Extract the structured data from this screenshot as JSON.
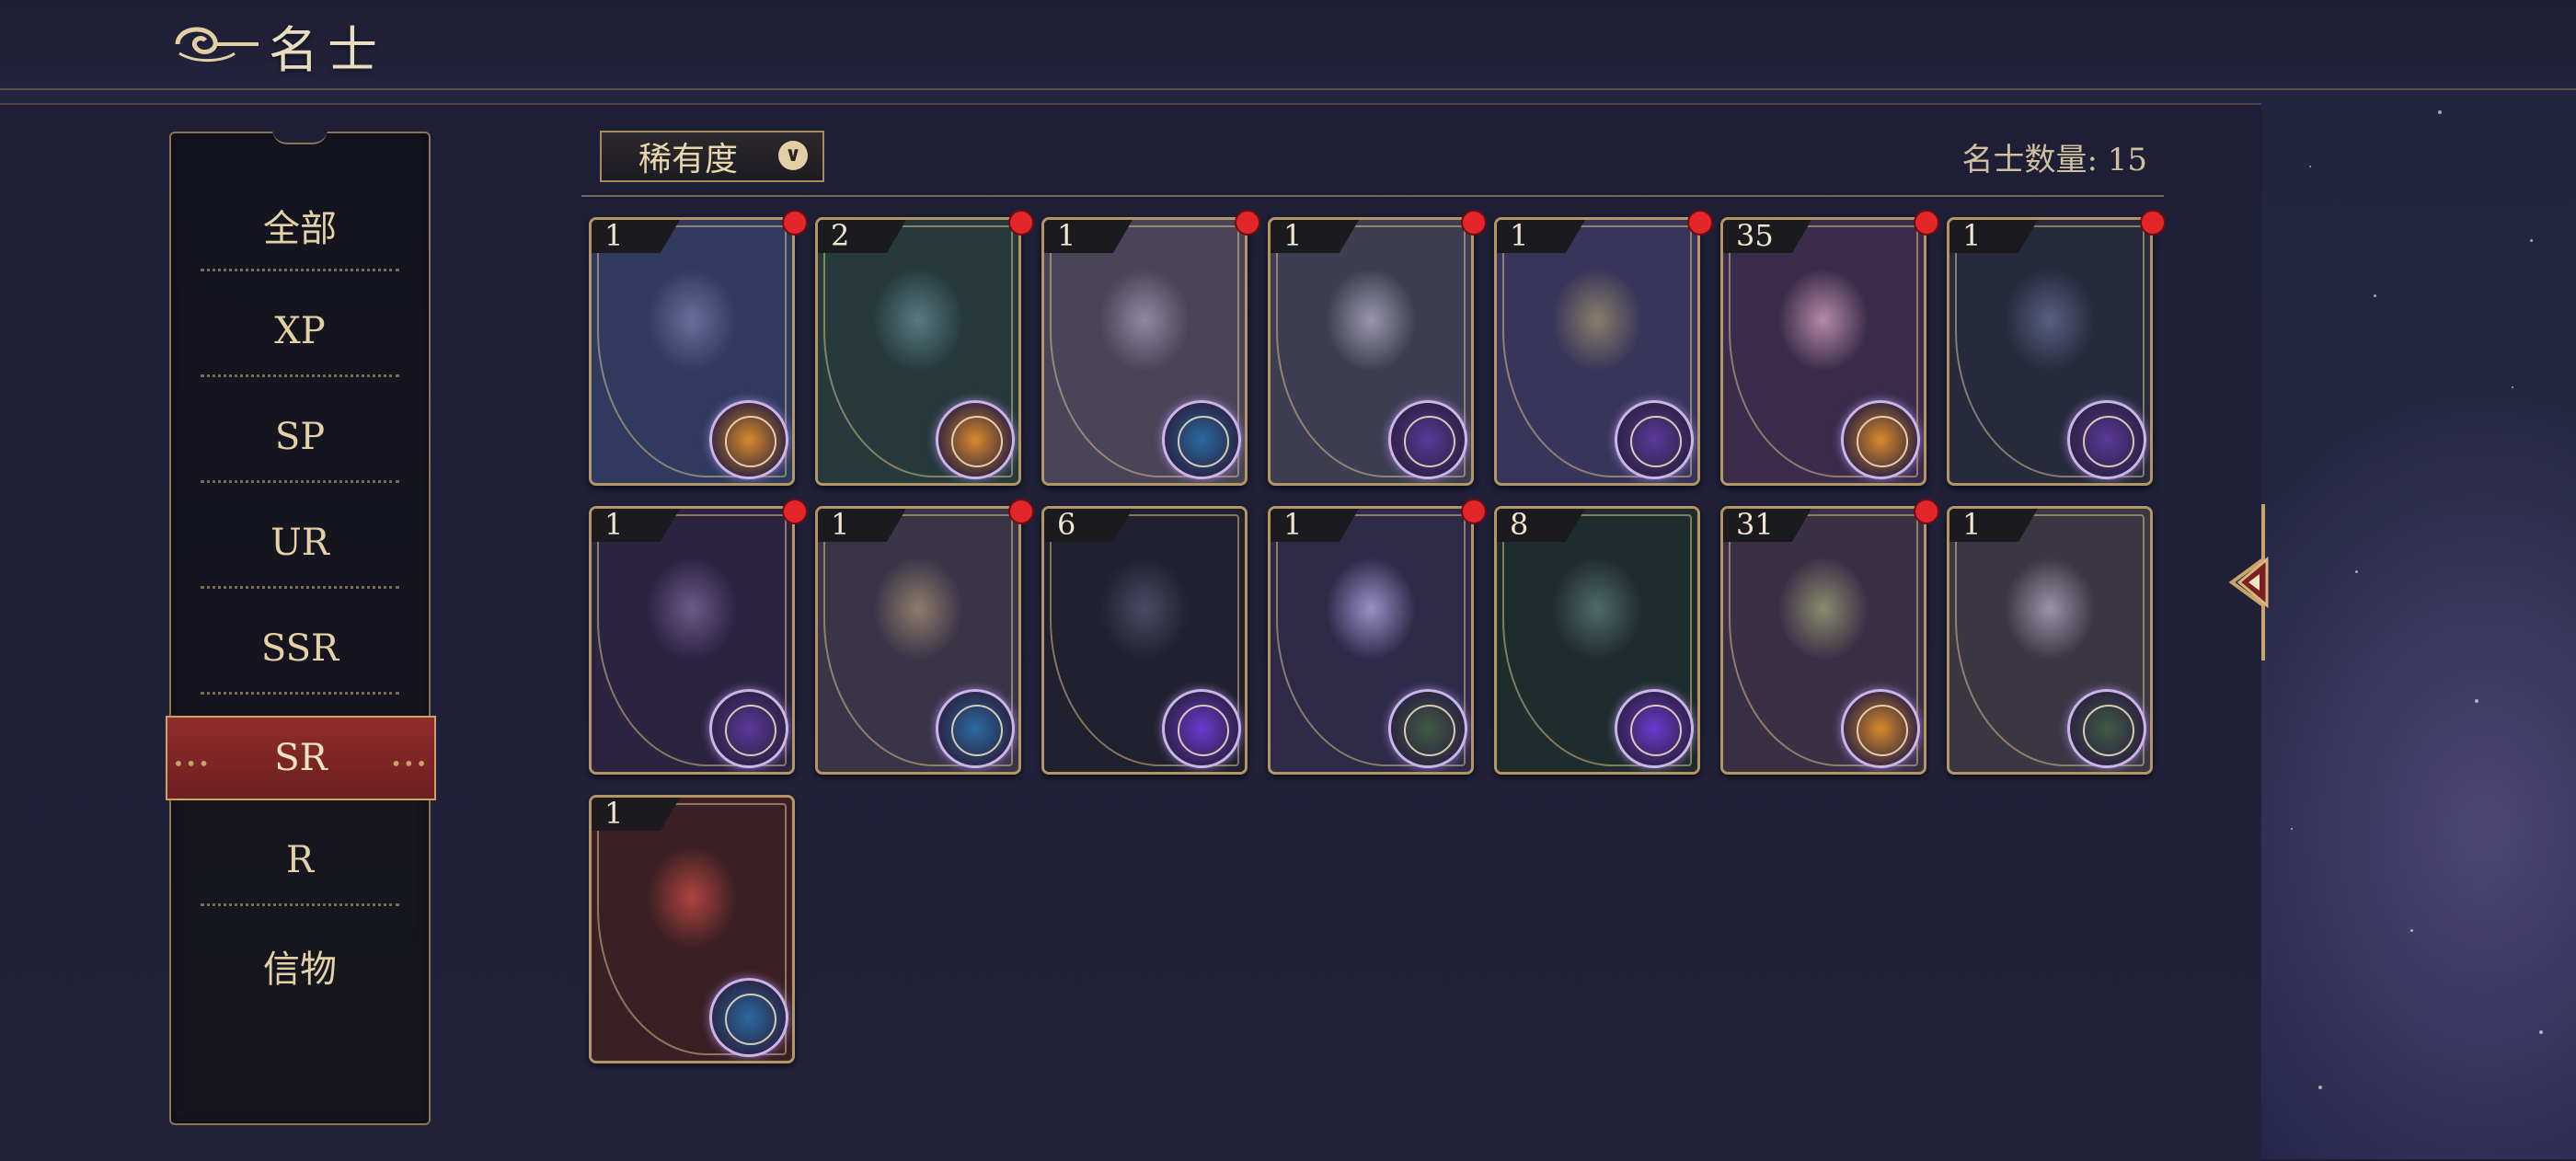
{
  "title": "名士",
  "filter": {
    "label": "稀有度"
  },
  "count_text": "名士数量: 15",
  "sidebar": {
    "items": [
      {
        "label": "全部"
      },
      {
        "label": "XP"
      },
      {
        "label": "SP"
      },
      {
        "label": "UR"
      },
      {
        "label": "SSR"
      },
      {
        "label": "SR",
        "active": true
      },
      {
        "label": "R"
      },
      {
        "label": "信物"
      }
    ]
  },
  "cards": [
    {
      "level": "1",
      "new": true,
      "emblem": "orange-emblem"
    },
    {
      "level": "2",
      "new": true,
      "emblem": "orange-emblem"
    },
    {
      "level": "1",
      "new": true,
      "emblem": "blue-emblem"
    },
    {
      "level": "1",
      "new": true,
      "emblem": "purple-emblem"
    },
    {
      "level": "1",
      "new": true,
      "emblem": "purple-emblem"
    },
    {
      "level": "35",
      "new": true,
      "emblem": "orange-emblem"
    },
    {
      "level": "1",
      "new": true,
      "emblem": "purple-emblem"
    },
    {
      "level": "1",
      "new": true,
      "emblem": "purple-emblem"
    },
    {
      "level": "1",
      "new": true,
      "emblem": "blue-emblem"
    },
    {
      "level": "6",
      "new": false,
      "emblem": "galaxy-emblem"
    },
    {
      "level": "1",
      "new": true,
      "emblem": "green-emblem"
    },
    {
      "level": "8",
      "new": false,
      "emblem": "galaxy-emblem"
    },
    {
      "level": "31",
      "new": true,
      "emblem": "orange-emblem"
    },
    {
      "level": "1",
      "new": false,
      "emblem": "green-emblem"
    },
    {
      "level": "1",
      "new": false,
      "emblem": "blue-emblem"
    }
  ],
  "colors": {
    "accent_gold": "#c9a46a",
    "active_red": "#8f2e2c",
    "new_badge": "#e3262a"
  }
}
